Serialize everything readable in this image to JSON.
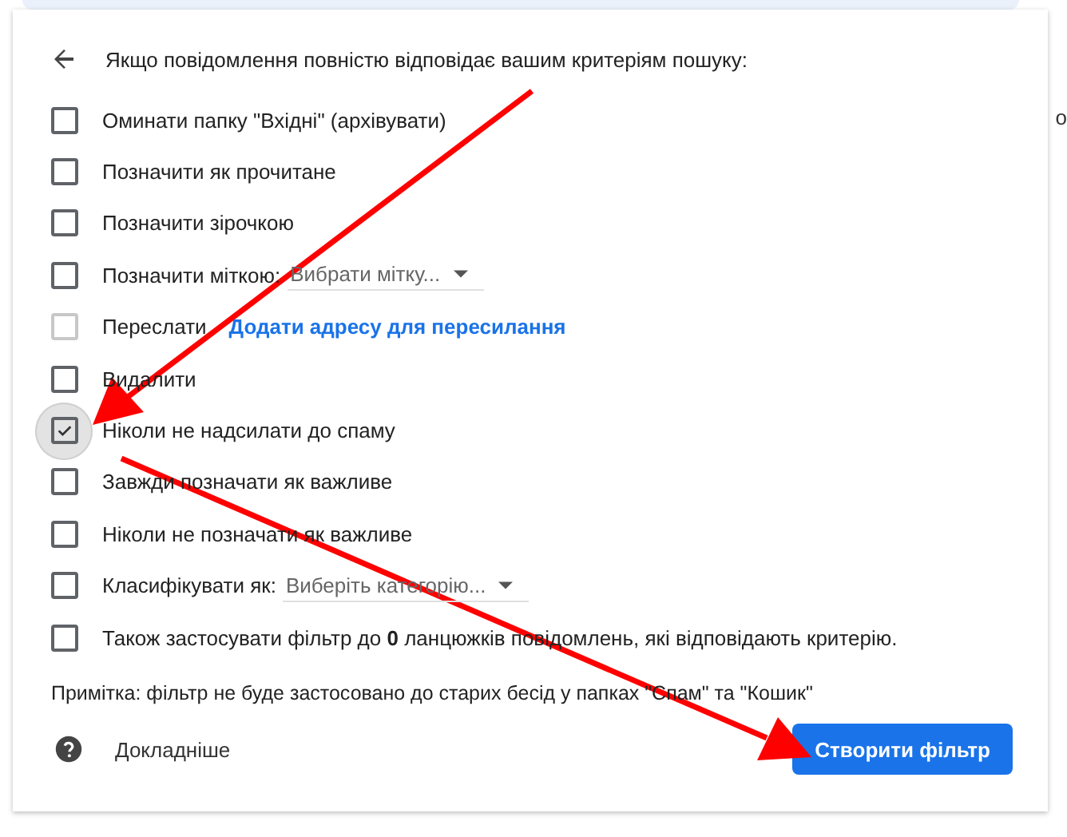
{
  "background_text": "о",
  "heading": "Якщо повідомлення повністю відповідає вашим критеріям пошуку:",
  "actions": [
    {
      "kind": "plain",
      "label": "Оминати папку \"Вхідні\" (архівувати)",
      "checked": false,
      "disabled": false,
      "focused": false
    },
    {
      "kind": "plain",
      "label": "Позначити як прочитане",
      "checked": false,
      "disabled": false,
      "focused": false
    },
    {
      "kind": "plain",
      "label": "Позначити зірочкою",
      "checked": false,
      "disabled": false,
      "focused": false
    },
    {
      "kind": "select",
      "label": "Позначити міткою:",
      "select": "Вибрати мітку...",
      "checked": false,
      "disabled": false,
      "focused": false
    },
    {
      "kind": "link",
      "label": "Переслати",
      "link": "Додати адресу для пересилання",
      "checked": false,
      "disabled": true,
      "focused": false
    },
    {
      "kind": "plain",
      "label": "Видалити",
      "checked": false,
      "disabled": false,
      "focused": false
    },
    {
      "kind": "plain",
      "label": "Ніколи не надсилати до спаму",
      "checked": true,
      "disabled": false,
      "focused": true
    },
    {
      "kind": "plain",
      "label": "Завжди позначати як важливе",
      "checked": false,
      "disabled": false,
      "focused": false
    },
    {
      "kind": "plain",
      "label": "Ніколи не позначати як важливе",
      "checked": false,
      "disabled": false,
      "focused": false
    },
    {
      "kind": "select",
      "label": "Класифікувати як:",
      "select": "Виберіть категорію...",
      "checked": false,
      "disabled": false,
      "focused": false
    },
    {
      "kind": "plain",
      "label": "Також застосувати фільтр до **0** ланцюжків повідомлень, які відповідають критерію.",
      "checked": false,
      "disabled": false,
      "focused": false
    }
  ],
  "note": "Примітка: фільтр не буде застосовано до старих бесід у папках \"Спам\" та \"Кошик\"",
  "learn_more": "Докладніше",
  "create_button": "Створити фільтр"
}
